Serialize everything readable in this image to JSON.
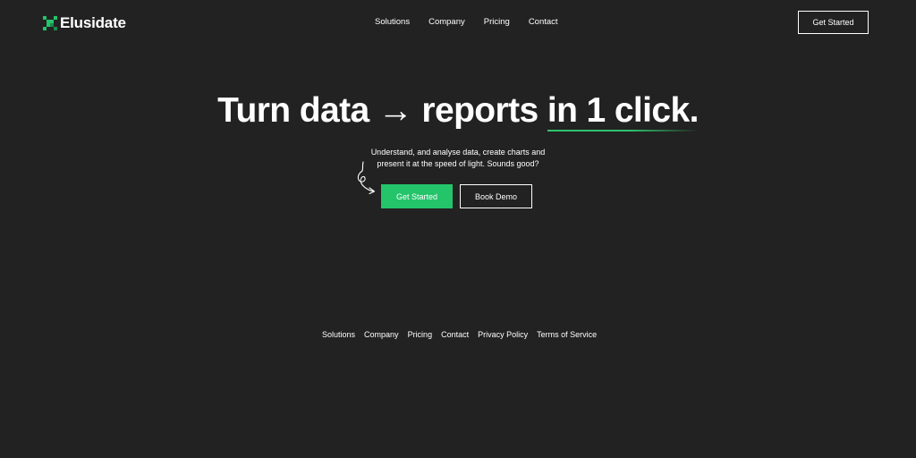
{
  "brand": {
    "name": "Elusidate",
    "accent_color": "#24c46b",
    "background_color": "#222222"
  },
  "nav": {
    "items": [
      "Solutions",
      "Company",
      "Pricing",
      "Contact"
    ]
  },
  "header": {
    "cta_label": "Get Started"
  },
  "hero": {
    "title_part1": "Turn data → reports ",
    "title_highlight": "in 1 click.",
    "subtitle_line1": "Understand, and analyse data, create charts and",
    "subtitle_line2": "present it at the speed of light. Sounds good?",
    "primary_cta": "Get Started",
    "secondary_cta": "Book Demo"
  },
  "footer": {
    "links": [
      "Solutions",
      "Company",
      "Pricing",
      "Contact",
      "Privacy Policy",
      "Terms of Service"
    ]
  },
  "icons": {
    "logo": "pixel-grid-logo-icon",
    "decoration": "squiggle-arrow-icon"
  }
}
